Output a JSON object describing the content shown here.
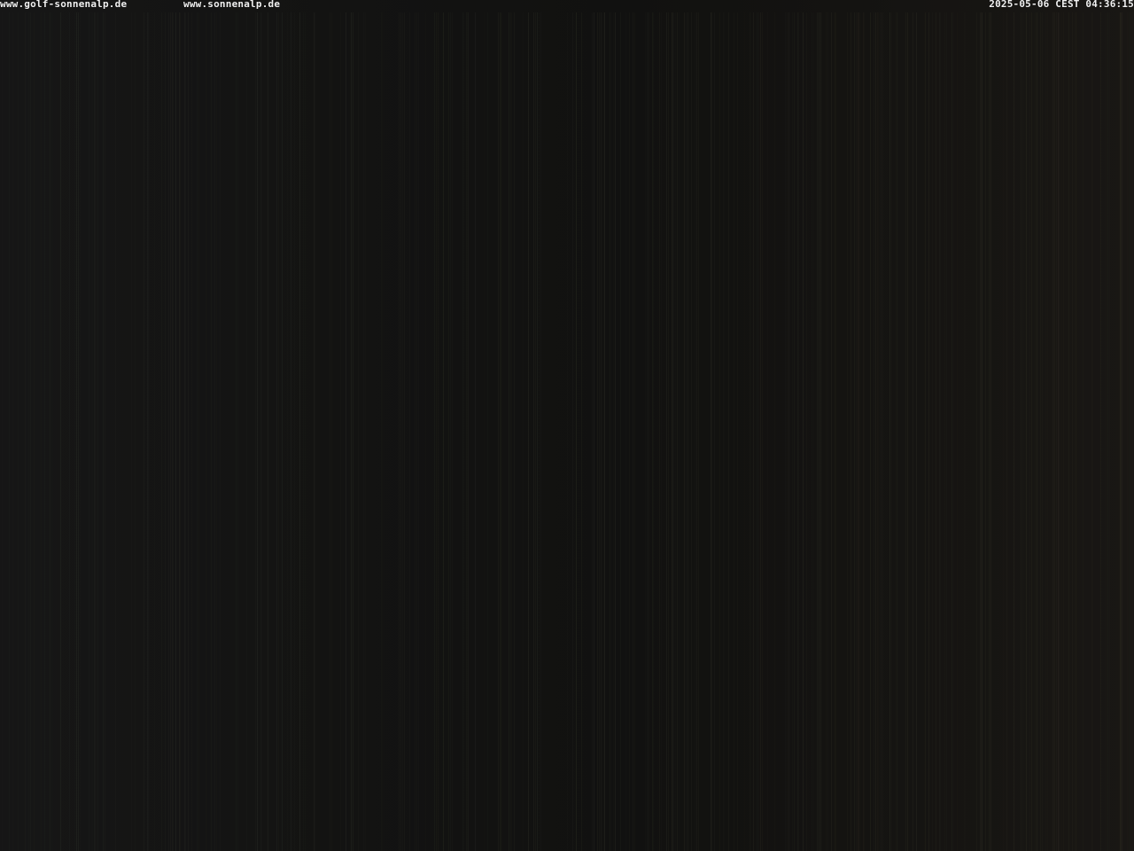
{
  "overlay": {
    "url_left": "www.golf-sonnenalp.de",
    "url_center": "www.sonnenalp.de",
    "timestamp": "2025-05-06 CEST 04:36:15"
  },
  "scene": {
    "description_colors": {
      "base": "#151515",
      "warm_right": "#1c1a16",
      "stripe_light": "#262a24"
    }
  }
}
